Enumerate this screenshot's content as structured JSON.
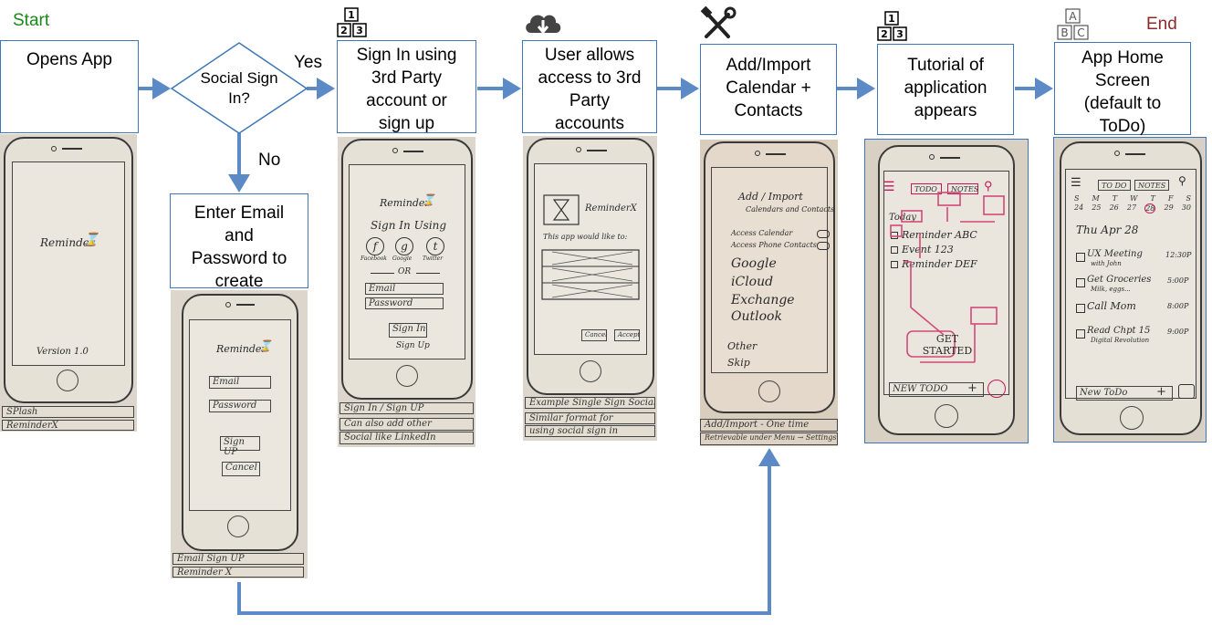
{
  "labels": {
    "start": "Start",
    "end": "End",
    "yes": "Yes",
    "no": "No"
  },
  "steps": {
    "opens_app": "Opens App",
    "social_decision": [
      "Social Sign",
      "In?"
    ],
    "enter_email": [
      "Enter Email",
      "and",
      "Password to",
      "create"
    ],
    "sign_in_third": [
      "Sign In using",
      "3rd Party",
      "account or",
      "sign up"
    ],
    "user_allows": [
      "User allows",
      "access to 3rd",
      "Party",
      "accounts"
    ],
    "add_import": [
      "Add/Import",
      "Calendar +",
      "Contacts"
    ],
    "tutorial": [
      "Tutorial of",
      "application",
      "appears"
    ],
    "home_screen": [
      "App Home",
      "Screen",
      "(default to",
      "ToDo)"
    ]
  },
  "sketches": {
    "splash": {
      "title": "Reminder",
      "version": "Version 1.0",
      "notes": [
        "SPlash",
        "ReminderX"
      ]
    },
    "email_signup": {
      "title": "Reminder",
      "fields": [
        "Email",
        "Password"
      ],
      "buttons": [
        "Sign UP",
        "Cancel"
      ],
      "notes": [
        "Email Sign UP",
        "Reminder X"
      ]
    },
    "sign_in": {
      "title": "Reminder",
      "heading": "Sign In Using",
      "providers": [
        "Facebook",
        "Google",
        "Twitter"
      ],
      "or": "OR",
      "fields": [
        "Email",
        "Password"
      ],
      "button": "Sign In",
      "link": "Sign Up",
      "notes": [
        "Sign In / Sign UP",
        "Can also add other",
        "Social like LinkedIn"
      ]
    },
    "permissions": {
      "title": "ReminderX",
      "prompt": "This app would like to:",
      "buttons": [
        "Cancel",
        "Accept"
      ],
      "notes": [
        "Example Single Sign Social",
        "Similar format for",
        "using social sign in"
      ]
    },
    "import": {
      "heading": "Add / Import",
      "subheading": "Calendars and Contacts",
      "toggles": [
        "Access Calendar",
        "Access Phone Contacts"
      ],
      "sources": [
        "Google",
        "iCloud",
        "Exchange",
        "Outlook"
      ],
      "other": [
        "Other",
        "Skip"
      ],
      "notes": [
        "Add/Import - One time",
        "Retrievable under Menu → Settings"
      ]
    },
    "tutorial": {
      "tabs": [
        "TODO",
        "NOTES"
      ],
      "today": "Today",
      "items": [
        "Reminder ABC",
        "Event 123",
        "Reminder DEF"
      ],
      "cta": "GET STARTED",
      "bottom": "NEW TODO"
    },
    "home": {
      "tabs": [
        "TO DO",
        "NOTES"
      ],
      "weekdays": [
        "S",
        "M",
        "T",
        "W",
        "T",
        "F",
        "S"
      ],
      "dates": [
        "24",
        "25",
        "26",
        "27",
        "28",
        "29",
        "30"
      ],
      "date_heading": "Thu Apr 28",
      "items": [
        {
          "text": "UX Meeting",
          "sub": "with John",
          "time": "12:30P"
        },
        {
          "text": "Get Groceries",
          "sub": "Milk, eggs...",
          "time": "5:00P"
        },
        {
          "text": "Call Mom",
          "sub": "",
          "time": "8:00P"
        },
        {
          "text": "Read Chpt 15",
          "sub": "Digital Revolution",
          "time": "9:00P"
        }
      ],
      "bottom": "New ToDo"
    }
  },
  "colors": {
    "arrow": "#5b8ac6",
    "box_border": "#3f76b8",
    "start": "#1a8a1a",
    "end": "#8b2a2a"
  }
}
